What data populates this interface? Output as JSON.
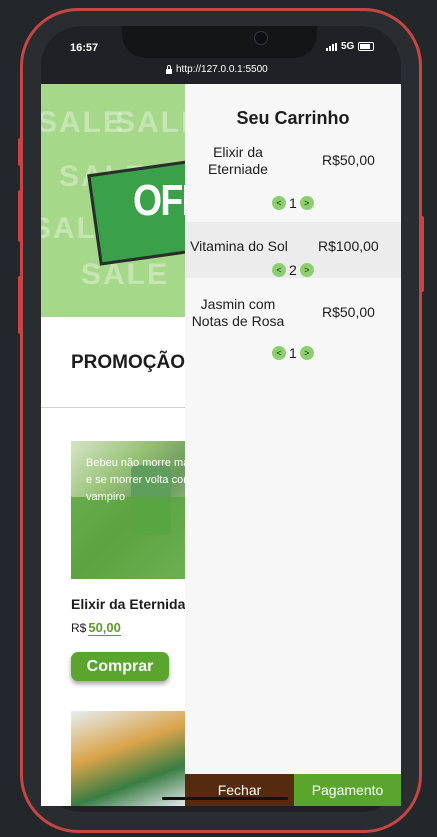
{
  "status_bar": {
    "time": "16:57",
    "network": "5G"
  },
  "browser": {
    "url": "http://127.0.0.1:5500"
  },
  "banner": {
    "sale_word": "SALE",
    "offer_word": "OFF"
  },
  "promo": {
    "title": "PROMOÇÃO"
  },
  "product": {
    "description": "Bebeu não morre mais e se morrer volta como vampiro",
    "name": "Elixir da Eternidade",
    "currency": "R$",
    "price": "50,00",
    "buy_label": "Comprar"
  },
  "cart": {
    "title": "Seu Carrinho",
    "items": [
      {
        "name": "Elixir da Eterniade",
        "price": "R$50,00",
        "quantity": "1"
      },
      {
        "name": "Vitamina do Sol",
        "price": "R$100,00",
        "quantity": "2"
      },
      {
        "name": "Jasmin com Notas de Rosa",
        "price": "R$50,00",
        "quantity": "1"
      }
    ],
    "decrease_symbol": "<",
    "increase_symbol": ">",
    "close_label": "Fechar",
    "pay_label": "Pagamento"
  },
  "colors": {
    "accent_green": "#5aa52d",
    "qty_green": "#8bd06d",
    "close_brown": "#552a0e",
    "phone_frame": "#c84545"
  }
}
